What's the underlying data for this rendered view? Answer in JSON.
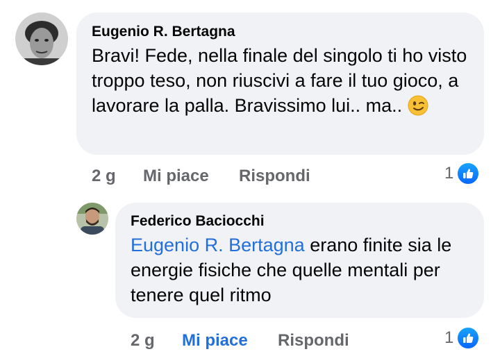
{
  "comments": [
    {
      "author": "Eugenio R. Bertagna",
      "text_before_emoji": "Bravi! Fede, nella finale del singolo ti ho visto troppo teso, non riuscivi a fare il tuo gioco, a lavorare la palla. Bravissimo lui.. ma..",
      "emoji": "winking-face-emoji",
      "time": "2 g",
      "like_label": "Mi piace",
      "reply_label": "Rispondi",
      "reaction_count": "1",
      "reaction_icon": "thumbs-up-icon"
    },
    {
      "author": "Federico Baciocchi",
      "mention": "Eugenio R. Bertagna",
      "text": "erano finite sia le energie fisiche che quelle mentali per tenere quel ritmo",
      "time": "2 g",
      "like_label": "Mi piace",
      "like_active": true,
      "reply_label": "Rispondi",
      "reaction_count": "1",
      "reaction_icon": "thumbs-up-icon"
    }
  ],
  "colors": {
    "bubble": "#f0f2f5",
    "mention": "#216fdb",
    "meta_text": "#65676b",
    "like_active": "#216fdb",
    "like_badge": "#0866ff"
  }
}
